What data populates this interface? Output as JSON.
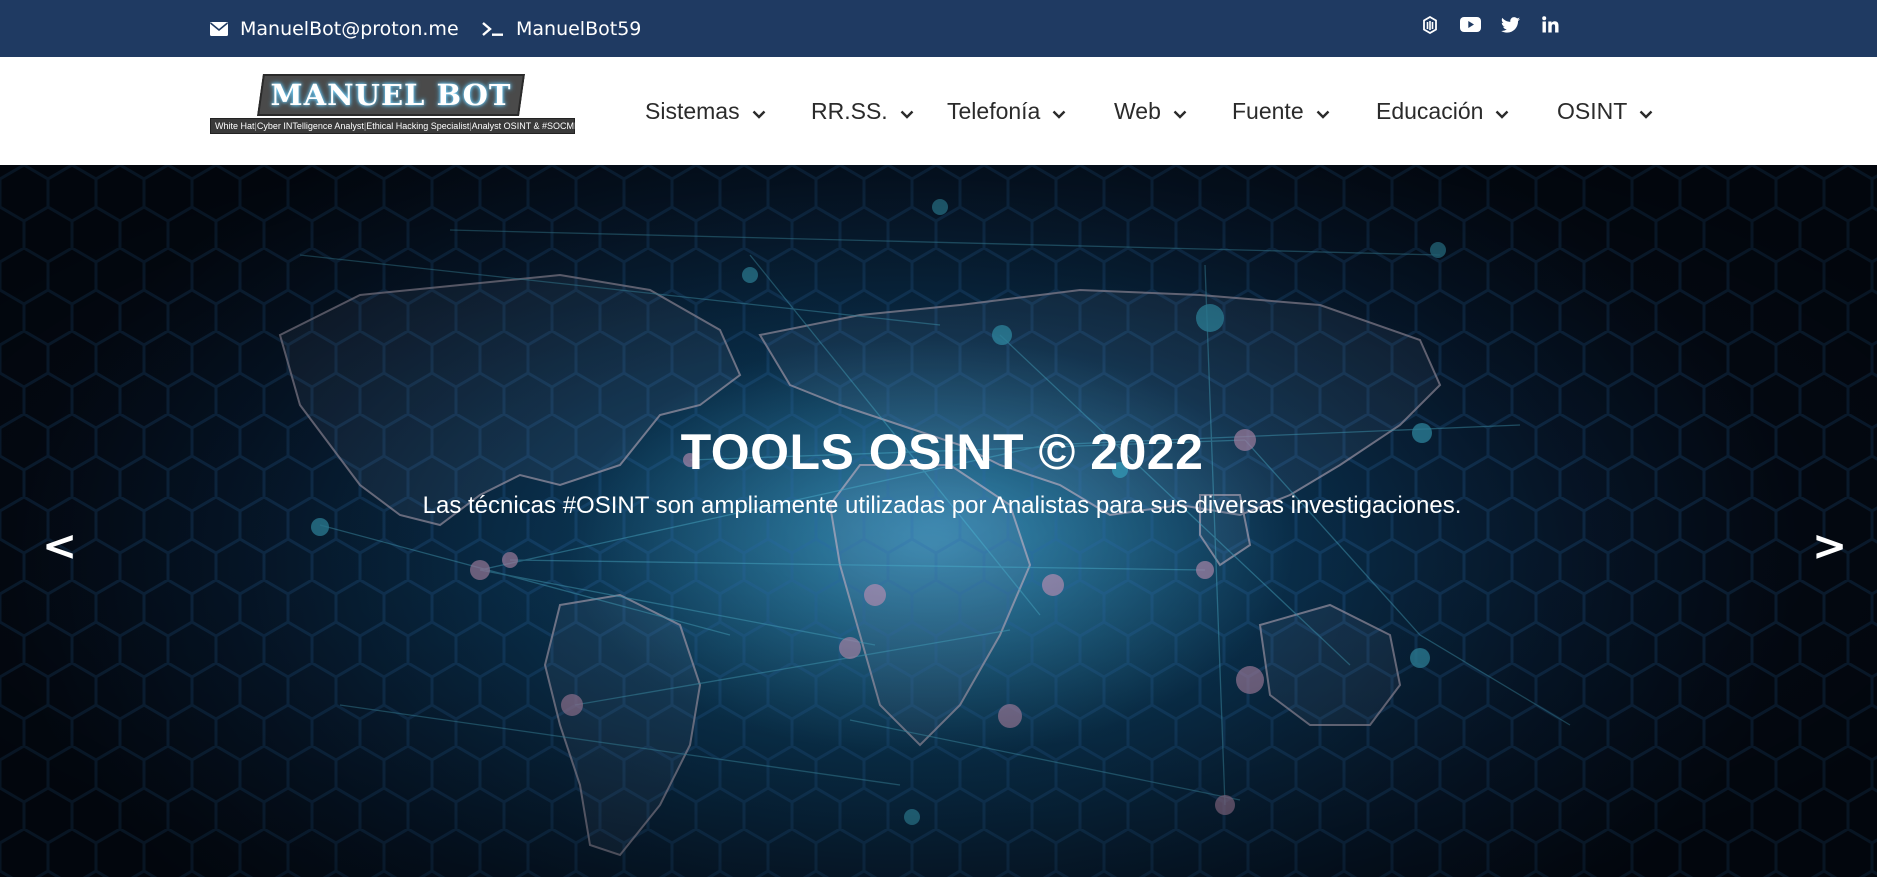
{
  "topbar": {
    "email": "ManuelBot@proton.me",
    "username": "ManuelBot59",
    "social": [
      {
        "icon": "keybase-icon"
      },
      {
        "icon": "youtube-icon"
      },
      {
        "icon": "twitter-icon"
      },
      {
        "icon": "linkedin-icon"
      }
    ]
  },
  "logo": {
    "title": "MANUEL BOT",
    "tagline": [
      "White Hat",
      "Cyber INTelligence Analyst",
      "Ethical Hacking Specialist",
      "Analyst OSINT & #SOCMINT"
    ]
  },
  "nav": {
    "items": [
      {
        "label": "Sistemas"
      },
      {
        "label": "RR.SS."
      },
      {
        "label": "Telefonía"
      },
      {
        "label": "Web"
      },
      {
        "label": "Fuente"
      },
      {
        "label": "Educación"
      },
      {
        "label": "OSINT"
      }
    ]
  },
  "hero": {
    "title": "TOOLS OSINT © 2022",
    "subtitle": "Las técnicas #OSINT son ampliamente utilizadas por Analistas para sus diversas investigaciones.",
    "prev_label": "<",
    "next_label": ">"
  },
  "colors": {
    "topbar_bg": "#1f3a62",
    "header_bg": "#ffffff",
    "nav_text": "#2b2b2b",
    "hero_text": "#ffffff"
  }
}
